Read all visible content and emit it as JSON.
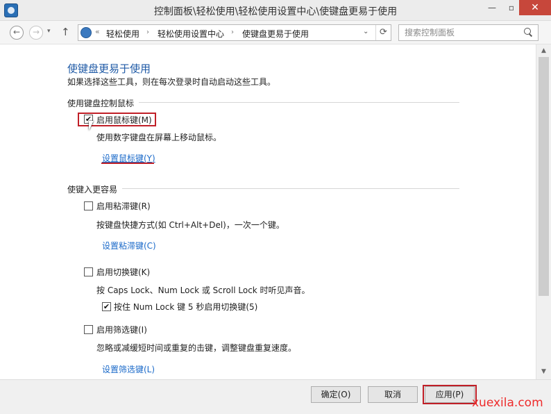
{
  "window": {
    "title": "控制面板\\轻松使用\\轻松使用设置中心\\使键盘更易于使用",
    "minimize": "—",
    "maximize": "▫",
    "close": "✕"
  },
  "nav": {
    "back_glyph": "←",
    "forward_glyph": "→",
    "dropdown_glyph": "▾",
    "up_glyph": "↑"
  },
  "address": {
    "chevron": "«",
    "breadcrumbs": [
      "轻松使用",
      "轻松使用设置中心",
      "使键盘更易于使用"
    ],
    "separator": "›",
    "dropdown_glyph": "⌄",
    "refresh_glyph": "⟳"
  },
  "search": {
    "placeholder": "搜索控制面板"
  },
  "page": {
    "title": "使键盘更易于使用",
    "subtitle": "如果选择这些工具，则在每次登录时自动启动这些工具。"
  },
  "mouse_section": {
    "heading": "使用键盘控制鼠标",
    "checkbox_label": "启用鼠标键(M)",
    "checked": true,
    "description": "使用数字键盘在屏幕上移动鼠标。",
    "link": "设置鼠标键(Y)"
  },
  "typing_section": {
    "heading": "使键入更容易",
    "sticky": {
      "checkbox_label": "启用粘滞键(R)",
      "checked": false,
      "description": "按键盘快捷方式(如 Ctrl+Alt+Del)，一次一个键。",
      "link": "设置粘滞键(C)"
    },
    "toggle": {
      "checkbox_label": "启用切换键(K)",
      "checked": false,
      "description": "按 Caps Lock、Num Lock 或 Scroll Lock 时听见声音。",
      "sub_checkbox_label": "按住 Num Lock 键 5 秒启用切换键(5)",
      "sub_checked": true
    },
    "filter": {
      "checkbox_label": "启用筛选键(I)",
      "checked": false,
      "description": "忽略或减缓短时间或重复的击键，调整键盘重复速度。",
      "link": "设置筛选键(L)"
    }
  },
  "check_glyph": "✔",
  "scroll": {
    "up_glyph": "▲",
    "down_glyph": "▼"
  },
  "footer": {
    "ok": "确定(O)",
    "cancel": "取消",
    "apply": "应用(P)"
  },
  "watermark": "xuexila.com",
  "colors": {
    "link": "#1b6ac9",
    "title": "#1f5aa6",
    "highlight": "#c01f27",
    "watermark": "#ee2b2b"
  }
}
